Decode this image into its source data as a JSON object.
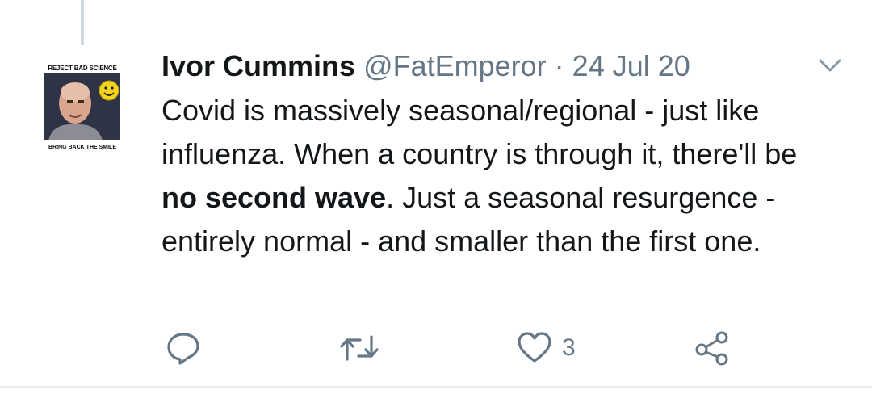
{
  "tweet": {
    "author_name": "Ivor Cummins",
    "handle": "@FatEmperor",
    "separator": " · ",
    "date": "24 Jul 20",
    "text_part1": "Covid is massively seasonal/regional - just like influenza. When a country is through it, there'll be ",
    "text_bold": "no second wave",
    "text_part2": ". Just a seasonal resurgence - entirely normal - and smaller than the first one."
  },
  "avatar": {
    "caption_top": "REJECT BAD SCIENCE",
    "caption_bottom": "BRING BACK THE SMILE"
  },
  "actions": {
    "reply_icon": "reply-icon",
    "retweet_icon": "retweet-icon",
    "like_icon": "heart-icon",
    "like_count": "3",
    "share_icon": "share-icon"
  },
  "colors": {
    "text": "#14171a",
    "secondary": "#657786",
    "divider": "#e6ecf0"
  }
}
